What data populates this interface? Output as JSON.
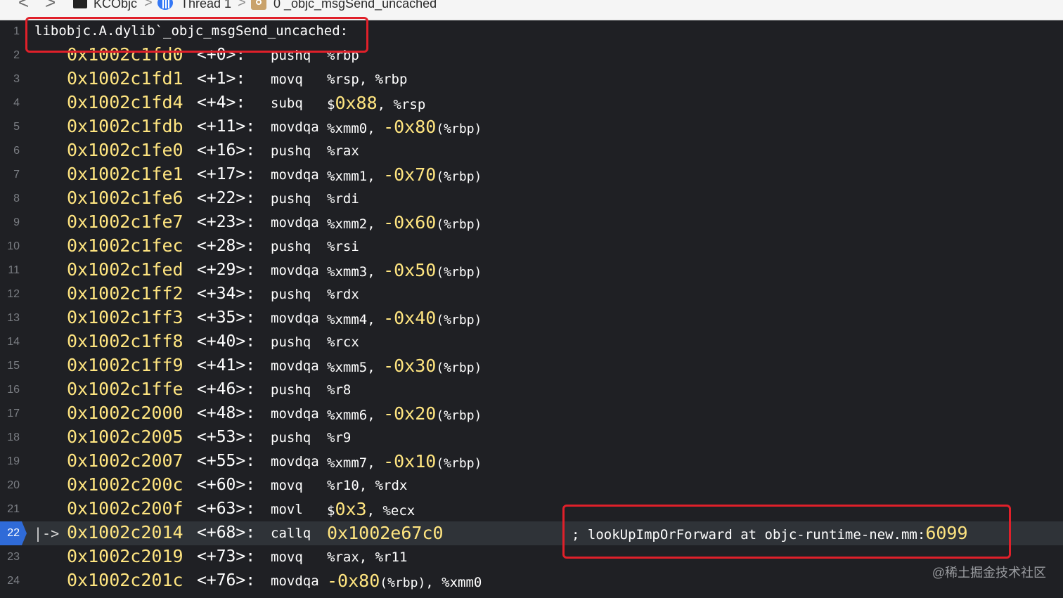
{
  "jumpbar": {
    "back": "<",
    "forward": ">",
    "project": "KCObjc",
    "thread": "Thread 1",
    "frame": "0 _objc_msgSend_uncached",
    "sep": ">"
  },
  "label_line": {
    "number": "1",
    "text": "libobjc.A.dylib`_objc_msgSend_uncached:"
  },
  "instructions": [
    {
      "n": "2",
      "addr": "0x1002c1fd0",
      "off": "<+0>:",
      "mn": "pushq",
      "ops": [
        {
          "t": "reg",
          "v": "%rbp"
        }
      ]
    },
    {
      "n": "3",
      "addr": "0x1002c1fd1",
      "off": "<+1>:",
      "mn": "movq",
      "ops": [
        {
          "t": "reg",
          "v": "%rsp, %rbp"
        }
      ]
    },
    {
      "n": "4",
      "addr": "0x1002c1fd4",
      "off": "<+4>:",
      "mn": "subq",
      "ops": [
        {
          "t": "reg",
          "v": "$"
        },
        {
          "t": "num",
          "v": "0x88"
        },
        {
          "t": "reg",
          "v": ", %rsp"
        }
      ]
    },
    {
      "n": "5",
      "addr": "0x1002c1fdb",
      "off": "<+11>:",
      "mn": "movdqa",
      "ops": [
        {
          "t": "reg",
          "v": "%xmm0, "
        },
        {
          "t": "num",
          "v": "-0x80"
        },
        {
          "t": "par",
          "v": "(%rbp)"
        }
      ]
    },
    {
      "n": "6",
      "addr": "0x1002c1fe0",
      "off": "<+16>:",
      "mn": "pushq",
      "ops": [
        {
          "t": "reg",
          "v": "%rax"
        }
      ]
    },
    {
      "n": "7",
      "addr": "0x1002c1fe1",
      "off": "<+17>:",
      "mn": "movdqa",
      "ops": [
        {
          "t": "reg",
          "v": "%xmm1, "
        },
        {
          "t": "num",
          "v": "-0x70"
        },
        {
          "t": "par",
          "v": "(%rbp)"
        }
      ]
    },
    {
      "n": "8",
      "addr": "0x1002c1fe6",
      "off": "<+22>:",
      "mn": "pushq",
      "ops": [
        {
          "t": "reg",
          "v": "%rdi"
        }
      ]
    },
    {
      "n": "9",
      "addr": "0x1002c1fe7",
      "off": "<+23>:",
      "mn": "movdqa",
      "ops": [
        {
          "t": "reg",
          "v": "%xmm2, "
        },
        {
          "t": "num",
          "v": "-0x60"
        },
        {
          "t": "par",
          "v": "(%rbp)"
        }
      ]
    },
    {
      "n": "10",
      "addr": "0x1002c1fec",
      "off": "<+28>:",
      "mn": "pushq",
      "ops": [
        {
          "t": "reg",
          "v": "%rsi"
        }
      ]
    },
    {
      "n": "11",
      "addr": "0x1002c1fed",
      "off": "<+29>:",
      "mn": "movdqa",
      "ops": [
        {
          "t": "reg",
          "v": "%xmm3, "
        },
        {
          "t": "num",
          "v": "-0x50"
        },
        {
          "t": "par",
          "v": "(%rbp)"
        }
      ]
    },
    {
      "n": "12",
      "addr": "0x1002c1ff2",
      "off": "<+34>:",
      "mn": "pushq",
      "ops": [
        {
          "t": "reg",
          "v": "%rdx"
        }
      ]
    },
    {
      "n": "13",
      "addr": "0x1002c1ff3",
      "off": "<+35>:",
      "mn": "movdqa",
      "ops": [
        {
          "t": "reg",
          "v": "%xmm4, "
        },
        {
          "t": "num",
          "v": "-0x40"
        },
        {
          "t": "par",
          "v": "(%rbp)"
        }
      ]
    },
    {
      "n": "14",
      "addr": "0x1002c1ff8",
      "off": "<+40>:",
      "mn": "pushq",
      "ops": [
        {
          "t": "reg",
          "v": "%rcx"
        }
      ]
    },
    {
      "n": "15",
      "addr": "0x1002c1ff9",
      "off": "<+41>:",
      "mn": "movdqa",
      "ops": [
        {
          "t": "reg",
          "v": "%xmm5, "
        },
        {
          "t": "num",
          "v": "-0x30"
        },
        {
          "t": "par",
          "v": "(%rbp)"
        }
      ]
    },
    {
      "n": "16",
      "addr": "0x1002c1ffe",
      "off": "<+46>:",
      "mn": "pushq",
      "ops": [
        {
          "t": "reg",
          "v": "%r8"
        }
      ]
    },
    {
      "n": "17",
      "addr": "0x1002c2000",
      "off": "<+48>:",
      "mn": "movdqa",
      "ops": [
        {
          "t": "reg",
          "v": "%xmm6, "
        },
        {
          "t": "num",
          "v": "-0x20"
        },
        {
          "t": "par",
          "v": "(%rbp)"
        }
      ]
    },
    {
      "n": "18",
      "addr": "0x1002c2005",
      "off": "<+53>:",
      "mn": "pushq",
      "ops": [
        {
          "t": "reg",
          "v": "%r9"
        }
      ]
    },
    {
      "n": "19",
      "addr": "0x1002c2007",
      "off": "<+55>:",
      "mn": "movdqa",
      "ops": [
        {
          "t": "reg",
          "v": "%xmm7, "
        },
        {
          "t": "num",
          "v": "-0x10"
        },
        {
          "t": "par",
          "v": "(%rbp)"
        }
      ]
    },
    {
      "n": "20",
      "addr": "0x1002c200c",
      "off": "<+60>:",
      "mn": "movq",
      "ops": [
        {
          "t": "reg",
          "v": "%r10, %rdx"
        }
      ]
    },
    {
      "n": "21",
      "addr": "0x1002c200f",
      "off": "<+63>:",
      "mn": "movl",
      "ops": [
        {
          "t": "reg",
          "v": "$"
        },
        {
          "t": "num",
          "v": "0x3"
        },
        {
          "t": "reg",
          "v": ", %ecx"
        }
      ]
    },
    {
      "n": "22",
      "addr": "0x1002c2014",
      "off": "<+68>:",
      "mn": "callq",
      "ops": [
        {
          "t": "num",
          "v": "0x1002e67c0"
        }
      ],
      "current": true,
      "comment": "; lookUpImpOrForward at objc-runtime-new.mm:",
      "comment_line": "6099"
    },
    {
      "n": "23",
      "addr": "0x1002c2019",
      "off": "<+73>:",
      "mn": "movq",
      "ops": [
        {
          "t": "reg",
          "v": "%rax, %r11"
        }
      ]
    },
    {
      "n": "24",
      "addr": "0x1002c201c",
      "off": "<+76>:",
      "mn": "movdqa",
      "ops": [
        {
          "t": "num",
          "v": "-0x80"
        },
        {
          "t": "par",
          "v": "(%rbp)"
        },
        {
          "t": "reg",
          "v": ", %xmm0"
        }
      ]
    }
  ],
  "pc_arrow": "|->",
  "watermark": "@稀土掘金技术社区",
  "colors": {
    "background": "#1f2024",
    "current_line": "#2f3338",
    "pc_marker": "#2f6bd8",
    "address": "#ffe580",
    "highlight_box": "#e0202a"
  }
}
